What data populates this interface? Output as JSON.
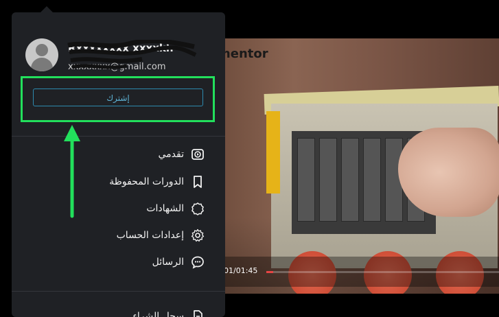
{
  "video": {
    "brand_text": "mentor",
    "time": "01/01:45",
    "progress_fraction": 0.03
  },
  "account": {
    "name": "Rxxxxxxxx xxxxkh",
    "email": "xxxxxxxx@gmail.com"
  },
  "subscribe_label": "إشترك",
  "menu": {
    "items": [
      {
        "label": "تقدمي",
        "icon": "play-circle-icon"
      },
      {
        "label": "الدورات المحفوظة",
        "icon": "bookmark-icon"
      },
      {
        "label": "الشهادات",
        "icon": "badge-icon"
      },
      {
        "label": "إعدادات الحساب",
        "icon": "gear-icon"
      },
      {
        "label": "الرسائل",
        "icon": "chat-icon"
      },
      {
        "label": "سجل الشراء",
        "icon": "document-icon"
      }
    ]
  },
  "colors": {
    "card_bg": "#1f2125",
    "highlight_border": "#22e05c",
    "button_border": "#2d8bb0",
    "progress": "#e64545"
  }
}
